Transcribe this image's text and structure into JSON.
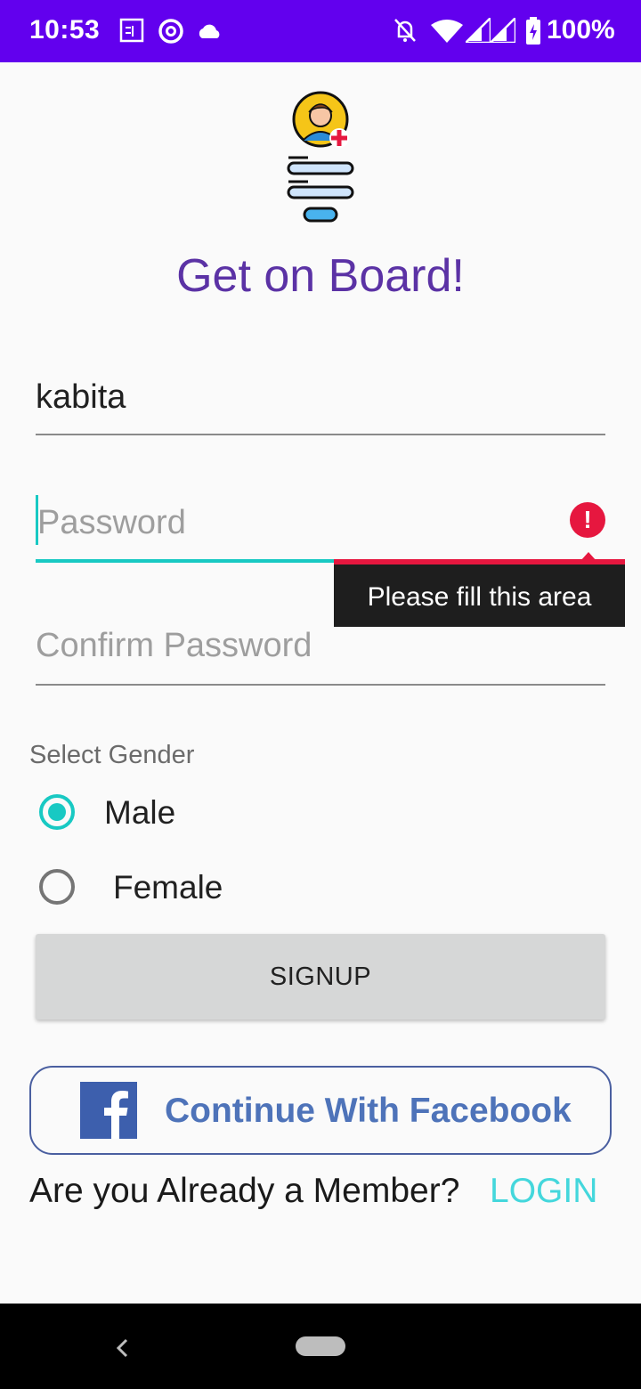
{
  "status_bar": {
    "time": "10:53",
    "battery": "100%",
    "icons": [
      "sim-card-icon",
      "at-sign-icon",
      "cloud-icon",
      "bell-off-icon",
      "wifi-icon",
      "signal-icon",
      "signal-icon",
      "battery-charging-icon"
    ]
  },
  "app": {
    "title": "Get on Board!",
    "username_value": "kabita",
    "password_placeholder": "Password",
    "confirm_password_placeholder": "Confirm Password",
    "password_error": "Please fill this area",
    "gender_label": "Select Gender",
    "gender_options": [
      "Male",
      "Female"
    ],
    "gender_selected": "Male",
    "signup_label": "SIGNUP",
    "facebook_label": "Continue With Facebook",
    "member_prompt": "Are you Already a Member?",
    "login_label": "LOGIN"
  },
  "colors": {
    "status_bar": "#6200ee",
    "title": "#5b32a5",
    "accent": "#18c9c3",
    "error": "#e6173f",
    "facebook": "#3d5fad",
    "login": "#44d7dc"
  }
}
